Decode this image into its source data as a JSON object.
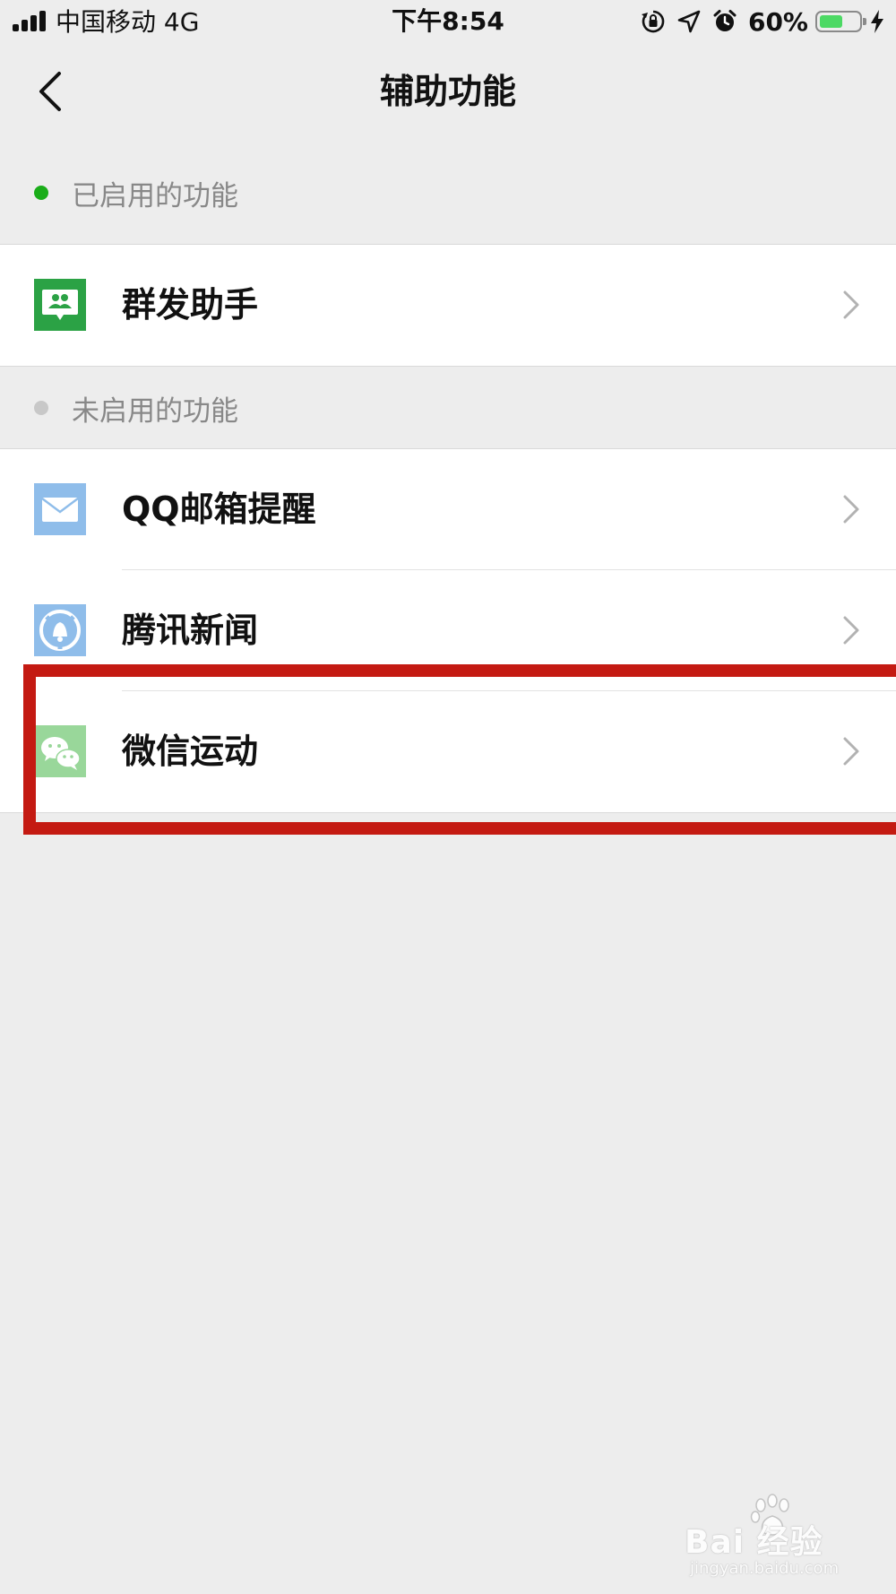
{
  "status_bar": {
    "carrier": "中国移动   4G",
    "time": "下午8:54",
    "battery_percent": "60%",
    "battery_level": 0.6,
    "icons": [
      "signal-icon",
      "rotation-lock-icon",
      "location-icon",
      "alarm-icon",
      "battery-icon",
      "charging-icon"
    ]
  },
  "nav": {
    "title": "辅助功能",
    "back_icon": "chevron-left-icon"
  },
  "sections": {
    "enabled_label": "已启用的功能",
    "disabled_label": "未启用的功能",
    "enabled_dot_color": "#1aad19",
    "disabled_dot_color": "#c8c8c8"
  },
  "enabled_items": [
    {
      "label": "群发助手",
      "icon": "mass-message-icon",
      "icon_color": "#2ba245"
    }
  ],
  "disabled_items": [
    {
      "label": "QQ邮箱提醒",
      "icon": "mail-icon",
      "icon_color": "#8fbdea"
    },
    {
      "label": "腾讯新闻",
      "icon": "news-bell-icon",
      "icon_color": "#8fbdea"
    },
    {
      "label": "微信运动",
      "icon": "wechat-icon",
      "icon_color": "#99d79a"
    }
  ],
  "highlight_color": "#c41a12",
  "watermark": {
    "main": "Bai  经验",
    "sub": "jingyan.baidu.com"
  }
}
